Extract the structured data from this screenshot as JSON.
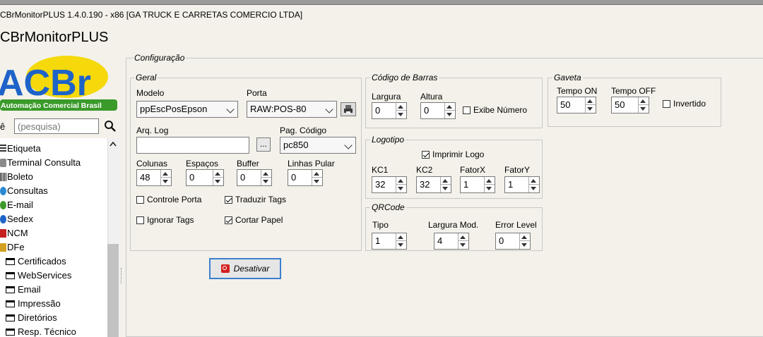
{
  "window": {
    "title": "CBrMonitorPLUS 1.4.0.190 - x86  [GA TRUCK E CARRETAS COMERCIO LTDA]",
    "app_name": "CBrMonitorPLUS"
  },
  "logo": {
    "text": "ACBr",
    "subtitle": "Automação Comercial Brasil",
    "colors": {
      "blue": "#1e63c8",
      "green": "#3a9a2a",
      "yellow": "#f5d90a"
    }
  },
  "search": {
    "label": "ê",
    "placeholder": "(pesquisa)",
    "icon": "search-icon"
  },
  "tree": {
    "items": [
      {
        "label": "Etiqueta",
        "icon": "label-icon"
      },
      {
        "label": "Terminal Consulta",
        "icon": "terminal-icon"
      },
      {
        "label": "Boleto",
        "icon": "boleto-icon"
      },
      {
        "label": "Consultas",
        "icon": "globe-icon"
      },
      {
        "label": "E-mail",
        "icon": "email-icon"
      },
      {
        "label": "Sedex",
        "icon": "sedex-icon"
      },
      {
        "label": "NCM",
        "icon": "ncm-icon"
      },
      {
        "label": "DFe",
        "icon": "dfe-icon"
      }
    ],
    "subitems": [
      {
        "label": "Certificados"
      },
      {
        "label": "WebServices"
      },
      {
        "label": "Email"
      },
      {
        "label": "Impressão"
      },
      {
        "label": "Diretórios"
      },
      {
        "label": "Resp. Técnico"
      }
    ]
  },
  "config": {
    "title": "Configuração",
    "geral": {
      "title": "Geral",
      "modelo_label": "Modelo",
      "modelo_value": "ppEscPosEpson",
      "porta_label": "Porta",
      "porta_value": "RAW:POS-80",
      "arqlog_label": "Arq. Log",
      "arqlog_button": "...",
      "pagcod_label": "Pag. Código",
      "pagcod_value": "pc850",
      "colunas_label": "Colunas",
      "colunas_value": "48",
      "espacos_label": "Espaços",
      "espacos_value": "0",
      "buffer_label": "Buffer",
      "buffer_value": "0",
      "linhas_label": "Linhas Pular",
      "linhas_value": "0",
      "controle_porta": "Controle Porta",
      "traduzir_tags": "Traduzir Tags",
      "ignorar_tags": "Ignorar Tags",
      "cortar_papel": "Cortar Papel",
      "controle_porta_checked": false,
      "traduzir_tags_checked": true,
      "ignorar_tags_checked": false,
      "cortar_papel_checked": true
    },
    "barras": {
      "title": "Código de Barras",
      "largura_label": "Largura",
      "largura_value": "0",
      "altura_label": "Altura",
      "altura_value": "0",
      "exibe_numero": "Exibe Número",
      "exibe_numero_checked": false
    },
    "logotipo": {
      "title": "Logotipo",
      "imprimir_logo": "Imprimir Logo",
      "imprimir_logo_checked": true,
      "kc1_label": "KC1",
      "kc1_value": "32",
      "kc2_label": "KC2",
      "kc2_value": "32",
      "fatorx_label": "FatorX",
      "fatorx_value": "1",
      "fatory_label": "FatorY",
      "fatory_value": "1"
    },
    "qrcode": {
      "title": "QRCode",
      "tipo_label": "Tipo",
      "tipo_value": "1",
      "largura_label": "Largura Mod.",
      "largura_value": "4",
      "error_label": "Error Level",
      "error_value": "0"
    },
    "gaveta": {
      "title": "Gaveta",
      "tempo_on_label": "Tempo ON",
      "tempo_on_value": "50",
      "tempo_off_label": "Tempo OFF",
      "tempo_off_value": "50",
      "invertido": "Invertido",
      "invertido_checked": false
    },
    "desativar_button": "Desativar"
  }
}
